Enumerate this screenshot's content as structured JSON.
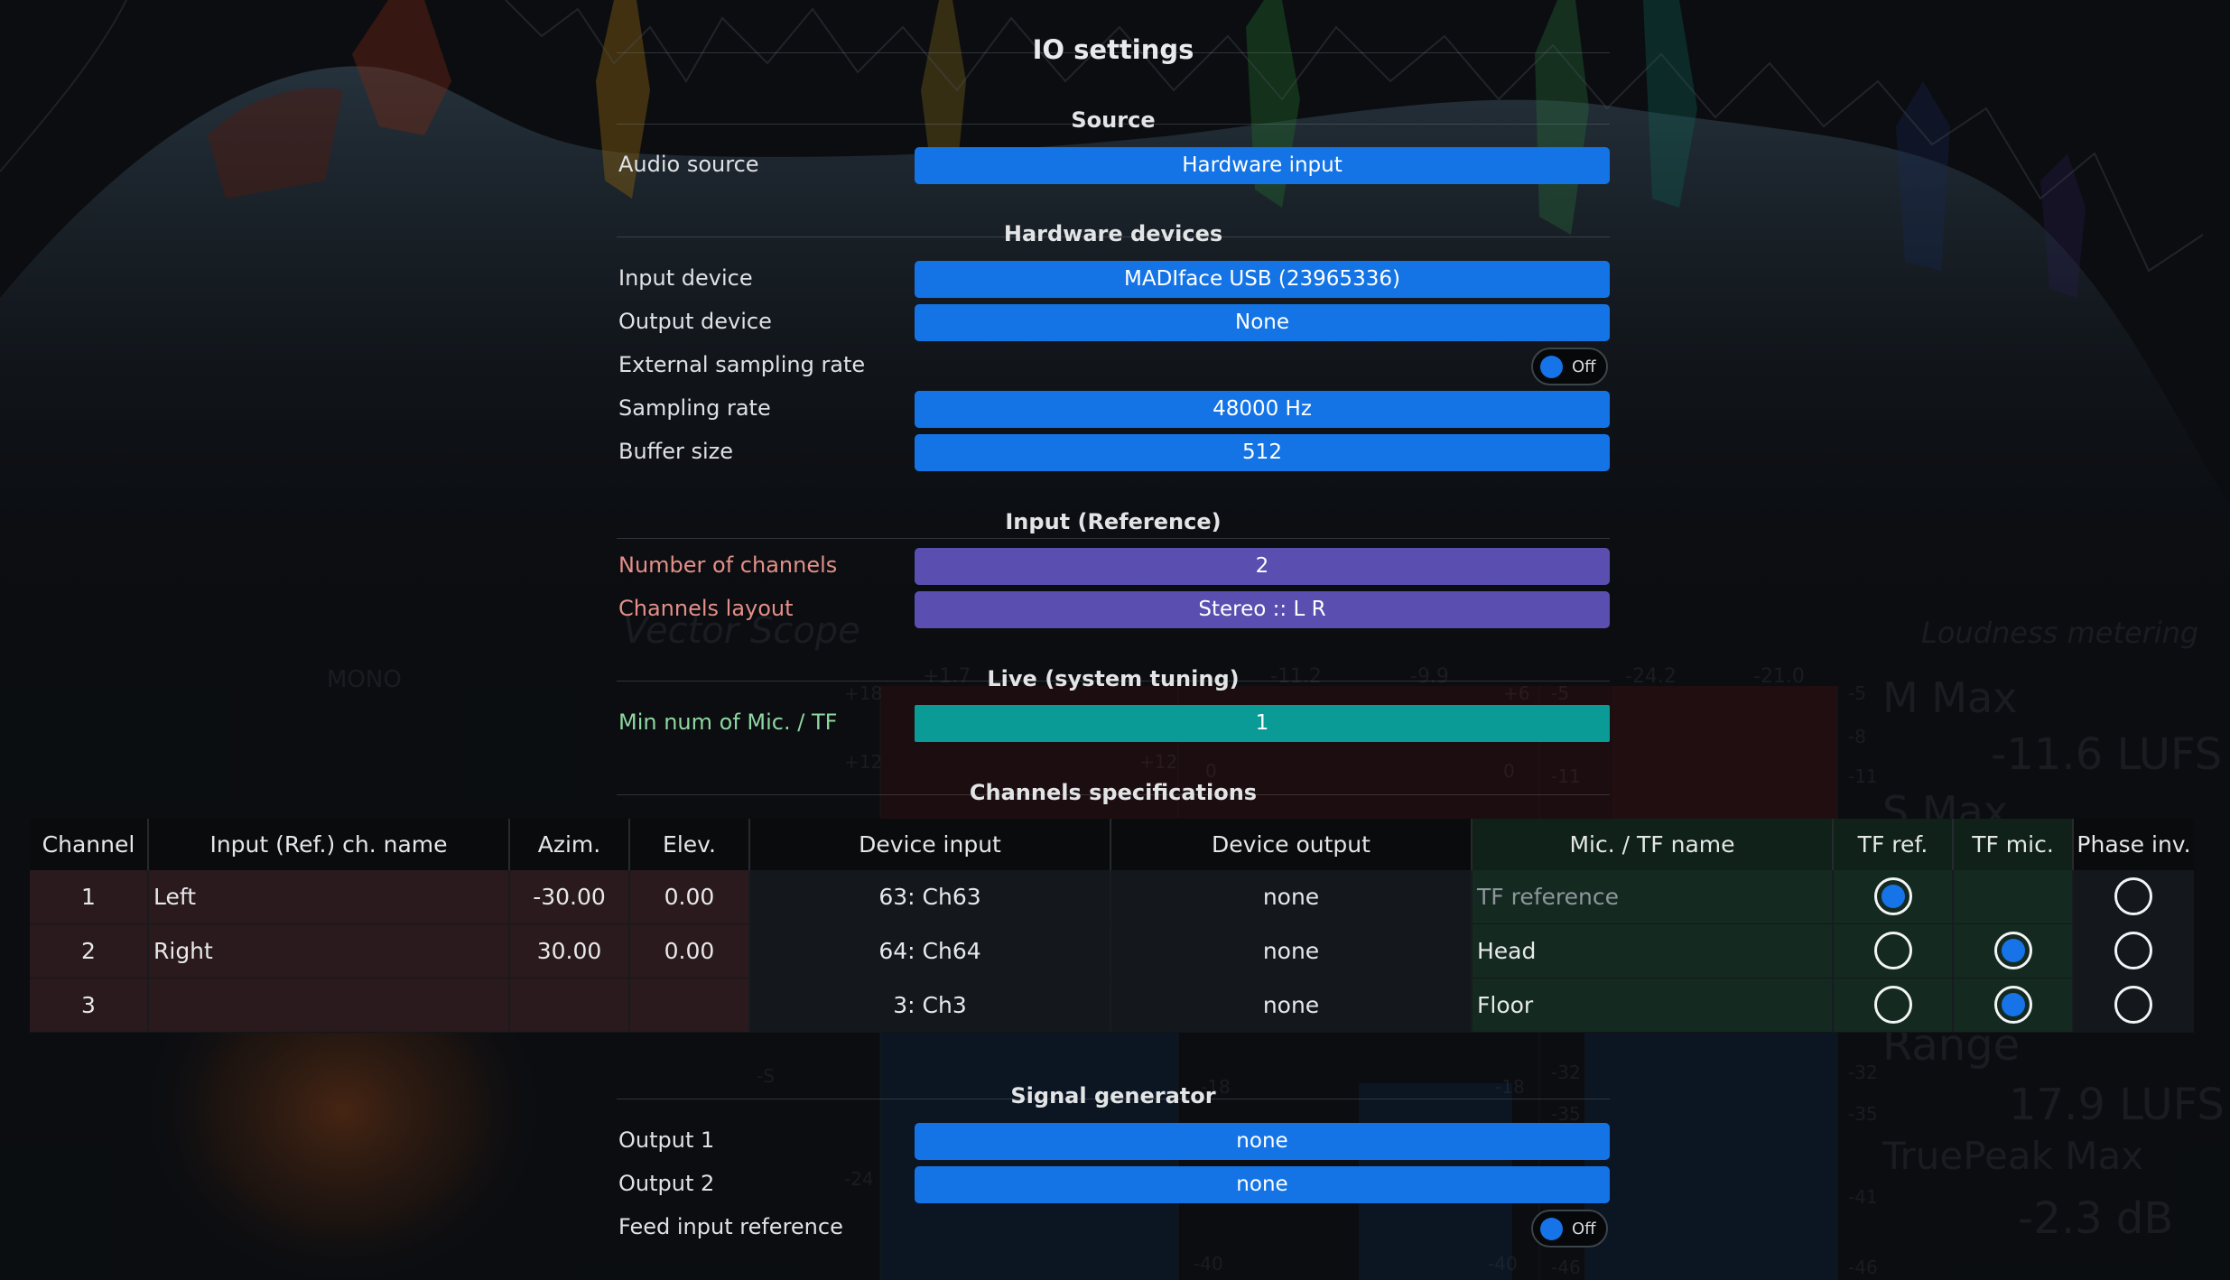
{
  "title": "IO settings",
  "colors": {
    "accent_blue": "#1474e6",
    "accent_purple": "#5a4fb0",
    "accent_teal": "#0a9b97",
    "label_pink": "#e48f88",
    "label_green": "#8fd7a0"
  },
  "background_text": {
    "vector_scope": "Vector Scope",
    "mono": "MONO",
    "loudness_metering": "Loudness metering",
    "m_max": "M Max",
    "m_max_value": "-11.6 LUFS",
    "s_max": "S Max",
    "range": "Range",
    "range_value": "17.9 LUFS",
    "truepeak_max": "TruePeak Max",
    "truepeak_value": "-2.3 dB",
    "scale_1": "+1.7",
    "scale_2": "-11.2",
    "scale_3": "-9.9",
    "scale_4": "-24.2",
    "scale_5": "-21.0",
    "tick_18a": "+18",
    "tick_12a": "+12",
    "tick_12b": "+12",
    "tick_0a": "0",
    "tick_0b": "0",
    "tick_m5": "-5",
    "tick_m8": "-8",
    "tick_m11": "-11",
    "tick_m11b": "-11",
    "tick_m5b": "-5",
    "tick_p6": "+6",
    "tick_m18a": "-18",
    "tick_m18b": "-18",
    "tick_m32a": "-32",
    "tick_m32b": "-32",
    "tick_m35a": "-35",
    "tick_m35b": "-35",
    "tick_m24": "-24",
    "tick_m41": "-41",
    "tick_m40a": "-40",
    "tick_m40b": "-40",
    "tick_m46a": "-46",
    "tick_m46b": "-46",
    "tick_s": "-S"
  },
  "sections": {
    "source": {
      "title": "Source",
      "audio_source": {
        "label": "Audio source",
        "value": "Hardware input"
      }
    },
    "hardware": {
      "title": "Hardware devices",
      "input_device": {
        "label": "Input device",
        "value": "MADIface USB (23965336)"
      },
      "output_device": {
        "label": "Output device",
        "value": "None"
      },
      "external_sampling_rate": {
        "label": "External sampling rate",
        "value": "Off"
      },
      "sampling_rate": {
        "label": "Sampling rate",
        "value": "48000 Hz"
      },
      "buffer_size": {
        "label": "Buffer size",
        "value": "512"
      }
    },
    "input_reference": {
      "title": "Input (Reference)",
      "num_channels": {
        "label": "Number of channels",
        "value": "2"
      },
      "channels_layout": {
        "label": "Channels layout",
        "value": "Stereo :: L R"
      }
    },
    "live": {
      "title": "Live (system tuning)",
      "min_mic": {
        "label": "Min num of Mic. / TF",
        "value": "1"
      }
    },
    "channels_spec": {
      "title": "Channels specifications"
    },
    "signal_generator": {
      "title": "Signal generator",
      "output1": {
        "label": "Output 1",
        "value": "none"
      },
      "output2": {
        "label": "Output 2",
        "value": "none"
      },
      "feed_input": {
        "label": "Feed input reference",
        "value": "Off"
      }
    }
  },
  "table": {
    "headers": [
      "Channel",
      "Input (Ref.) ch. name",
      "Azim.",
      "Elev.",
      "Device input",
      "Device output",
      "Mic. / TF name",
      "TF ref.",
      "TF mic.",
      "Phase inv."
    ],
    "rows": [
      {
        "channel": "1",
        "name": "Left",
        "azim": "-30.00",
        "elev": "0.00",
        "device_input": "63: Ch63",
        "device_output": "none",
        "mic_name": "TF reference",
        "tf_ref": true,
        "tf_mic": null,
        "phase_inv": false
      },
      {
        "channel": "2",
        "name": "Right",
        "azim": "30.00",
        "elev": "0.00",
        "device_input": "64: Ch64",
        "device_output": "none",
        "mic_name": "Head",
        "tf_ref": false,
        "tf_mic": true,
        "phase_inv": false
      },
      {
        "channel": "3",
        "name": "",
        "azim": "",
        "elev": "",
        "device_input": "3: Ch3",
        "device_output": "none",
        "mic_name": "Floor",
        "tf_ref": false,
        "tf_mic": true,
        "phase_inv": false
      }
    ]
  }
}
